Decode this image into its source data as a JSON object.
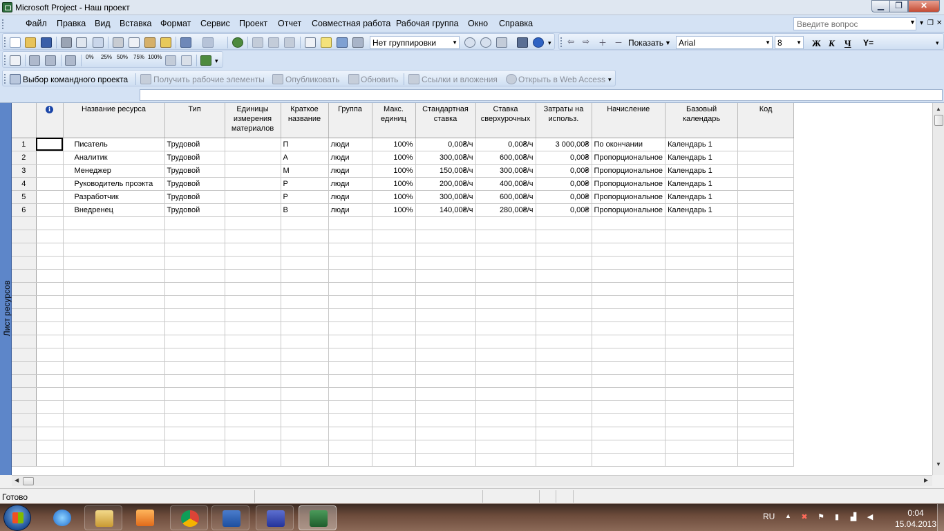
{
  "window": {
    "title": "Microsoft Project - Наш проект",
    "min_glyph": "▁",
    "max_glyph": "❐",
    "close_glyph": "✕"
  },
  "menu": {
    "items": [
      "Файл",
      "Правка",
      "Вид",
      "Вставка",
      "Формат",
      "Сервис",
      "Проект",
      "Отчет",
      "Совместная работа",
      "Рабочая группа",
      "Окно",
      "Справка"
    ],
    "help_placeholder": "Введите вопрос",
    "help_drop": "▼",
    "doc_min": "▾",
    "doc_restore": "❐",
    "doc_close": "✕"
  },
  "toolbar1": {
    "grouping_value": "Нет группировки",
    "show_label": "Показать",
    "font_value": "Arial",
    "size_value": "8",
    "bold": "Ж",
    "italic": "К",
    "underline": "Ч",
    "filter": "Y="
  },
  "toolbar2": {
    "pct_labels": [
      "0%",
      "25%",
      "50%",
      "75%",
      "100%"
    ]
  },
  "toolbar3": {
    "team_project": "Выбор командного проекта",
    "get_items": "Получить рабочие элементы",
    "publish": "Опубликовать",
    "refresh": "Обновить",
    "links": "Ссылки и вложения",
    "web_access": "Открыть в Web Access"
  },
  "view": {
    "label": "Лист ресурсов"
  },
  "sheet": {
    "info_icon": "i",
    "columns": [
      "Название ресурса",
      "Тип",
      "Единицы измерения материалов",
      "Краткое название",
      "Группа",
      "Макс. единиц",
      "Стандартная ставка",
      "Ставка сверхурочных",
      "Затраты на использ.",
      "Начисление",
      "Базовый календарь",
      "Код"
    ],
    "rows": [
      {
        "id": "1",
        "name": "Писатель",
        "type": "Трудовой",
        "mat": "",
        "short": "П",
        "group": "люди",
        "max": "100%",
        "std": "0,00₴/ч",
        "ovt": "0,00₴/ч",
        "cost": "3 000,00₴",
        "accrue": "По окончании",
        "cal": "Календарь 1",
        "code": ""
      },
      {
        "id": "2",
        "name": "Аналитик",
        "type": "Трудовой",
        "mat": "",
        "short": "А",
        "group": "люди",
        "max": "100%",
        "std": "300,00₴/ч",
        "ovt": "600,00₴/ч",
        "cost": "0,00₴",
        "accrue": "Пропорциональное",
        "cal": "Календарь 1",
        "code": ""
      },
      {
        "id": "3",
        "name": "Менеджер",
        "type": "Трудовой",
        "mat": "",
        "short": "М",
        "group": "люди",
        "max": "100%",
        "std": "150,00₴/ч",
        "ovt": "300,00₴/ч",
        "cost": "0,00₴",
        "accrue": "Пропорциональное",
        "cal": "Календарь 1",
        "code": ""
      },
      {
        "id": "4",
        "name": "Руководитель проэкта",
        "type": "Трудовой",
        "mat": "",
        "short": "Р",
        "group": "люди",
        "max": "100%",
        "std": "200,00₴/ч",
        "ovt": "400,00₴/ч",
        "cost": "0,00₴",
        "accrue": "Пропорциональное",
        "cal": "Календарь 1",
        "code": ""
      },
      {
        "id": "5",
        "name": "Разработчик",
        "type": "Трудовой",
        "mat": "",
        "short": "Р",
        "group": "люди",
        "max": "100%",
        "std": "300,00₴/ч",
        "ovt": "600,00₴/ч",
        "cost": "0,00₴",
        "accrue": "Пропорциональное",
        "cal": "Календарь 1",
        "code": ""
      },
      {
        "id": "6",
        "name": "Внедренец",
        "type": "Трудовой",
        "mat": "",
        "short": "В",
        "group": "люди",
        "max": "100%",
        "std": "140,00₴/ч",
        "ovt": "280,00₴/ч",
        "cost": "0,00₴",
        "accrue": "Пропорциональное",
        "cal": "Календарь 1",
        "code": ""
      }
    ]
  },
  "status": {
    "text": "Готово"
  },
  "taskbar": {
    "lang": "RU",
    "time": "0:04",
    "date": "15.04.2013",
    "tray_up": "▲",
    "apps": [
      "internet-explorer",
      "file-explorer",
      "media-player",
      "chrome",
      "word",
      "save-disk",
      "project"
    ]
  },
  "colors": {
    "menubar": "#d4e2f4",
    "viewbar": "#5d86c9",
    "close": "#c44a32"
  }
}
